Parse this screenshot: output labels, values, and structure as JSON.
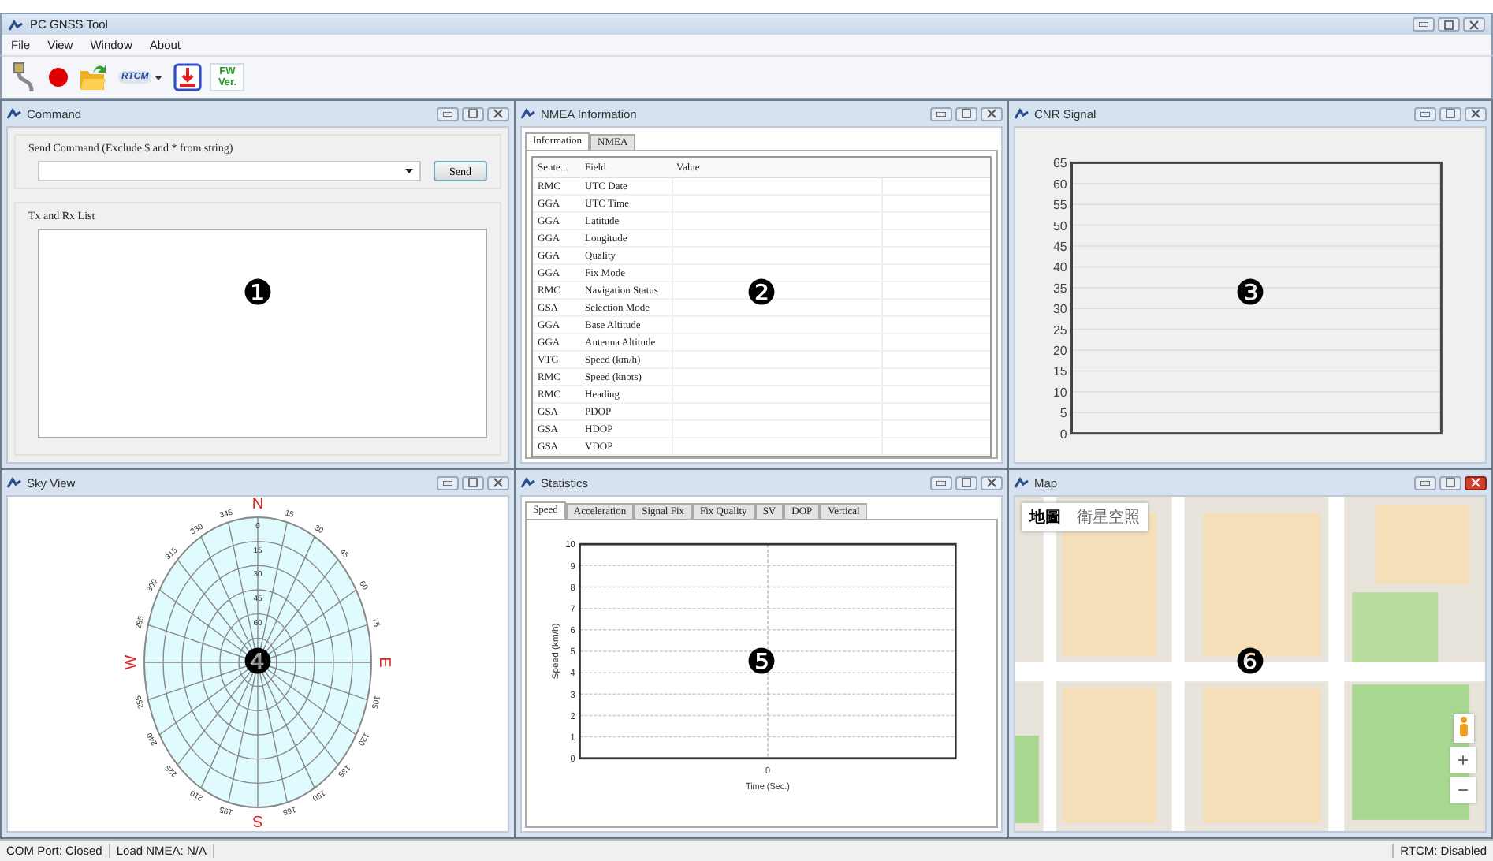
{
  "window": {
    "title": "PC GNSS Tool"
  },
  "menu": [
    "File",
    "View",
    "Window",
    "About"
  ],
  "toolbar": [
    {
      "kind": "cable"
    },
    {
      "kind": "record"
    },
    {
      "kind": "open"
    },
    {
      "kind": "rtcm",
      "label": "RTCM"
    },
    {
      "kind": "download"
    },
    {
      "kind": "fw",
      "label": "FW Ver."
    }
  ],
  "command": {
    "title": "Command",
    "active": false,
    "marker": "❶",
    "send_label": "Send Command (Exclude $ and * from string)",
    "send_button": "Send",
    "list_label": "Tx and Rx List"
  },
  "nmea": {
    "title": "NMEA Information",
    "active": false,
    "marker": "❷",
    "tabs": [
      {
        "label": "Information",
        "selected": true
      },
      {
        "label": "NMEA",
        "selected": false
      }
    ],
    "columns": [
      "Sente...",
      "Field",
      "Value"
    ],
    "rows": [
      {
        "sentence": "RMC",
        "field": "UTC Date"
      },
      {
        "sentence": "GGA",
        "field": "UTC Time"
      },
      {
        "sentence": "GGA",
        "field": "Latitude"
      },
      {
        "sentence": "GGA",
        "field": "Longitude"
      },
      {
        "sentence": "GGA",
        "field": "Quality"
      },
      {
        "sentence": "GGA",
        "field": "Fix Mode"
      },
      {
        "sentence": "RMC",
        "field": "Navigation Status"
      },
      {
        "sentence": "GSA",
        "field": "Selection Mode"
      },
      {
        "sentence": "GGA",
        "field": "Base Altitude"
      },
      {
        "sentence": "GGA",
        "field": "Antenna Altitude"
      },
      {
        "sentence": "VTG",
        "field": "Speed (km/h)"
      },
      {
        "sentence": "RMC",
        "field": "Speed (knots)"
      },
      {
        "sentence": "RMC",
        "field": "Heading"
      },
      {
        "sentence": "GSA",
        "field": "PDOP"
      },
      {
        "sentence": "GSA",
        "field": "HDOP"
      },
      {
        "sentence": "GSA",
        "field": "VDOP"
      }
    ]
  },
  "cnr": {
    "title": "CNR Signal",
    "active": false,
    "marker": "❸",
    "y_axis_labels": [
      "65",
      "60",
      "55",
      "50",
      "45",
      "40",
      "35",
      "30",
      "25",
      "20",
      "15",
      "10",
      "5",
      "0"
    ]
  },
  "sky_view": {
    "title": "Sky View",
    "active": false,
    "marker": "❹",
    "compass": [
      "N",
      "E",
      "S",
      "W"
    ],
    "azimuth_labels": [
      "15",
      "30",
      "45",
      "60",
      "75",
      "105",
      "120",
      "135",
      "150",
      "165",
      "195",
      "210",
      "225",
      "240",
      "255",
      "285",
      "300",
      "315",
      "330",
      "345"
    ],
    "elevation_labels": [
      "0",
      "15",
      "30",
      "45",
      "60"
    ]
  },
  "statistics": {
    "title": "Statistics",
    "active": false,
    "marker": "❺",
    "tabs": [
      {
        "label": "Speed",
        "selected": true
      },
      {
        "label": "Acceleration",
        "selected": false
      },
      {
        "label": "Signal Fix",
        "selected": false
      },
      {
        "label": "Fix Quality",
        "selected": false
      },
      {
        "label": "SV",
        "selected": false
      },
      {
        "label": "DOP",
        "selected": false
      },
      {
        "label": "Vertical",
        "selected": false
      }
    ],
    "x_axis_title": "Time (Sec.)",
    "y_axis_title": "Speed (km/h)",
    "x_axis_labels": [
      "0"
    ],
    "y_axis_labels": [
      "10",
      "9",
      "8",
      "7",
      "6",
      "5",
      "4",
      "3",
      "2",
      "1",
      "0"
    ]
  },
  "map": {
    "title": "Map",
    "active": true,
    "marker": "❻",
    "map_types": [
      {
        "label": "地圖",
        "selected": true
      },
      {
        "label": "衛星空照",
        "selected": false
      }
    ],
    "zoom_in": "+",
    "zoom_out": "−"
  },
  "status_bar": {
    "com_port": "COM Port: Closed",
    "load_nmea": "Load NMEA: N/A",
    "rtcm": "RTCM: Disabled"
  }
}
